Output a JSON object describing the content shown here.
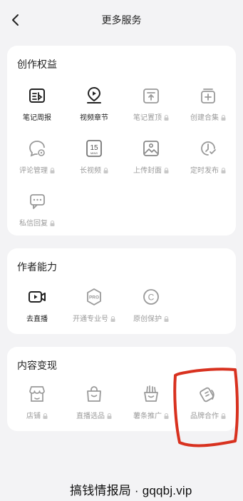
{
  "nav": {
    "title": "更多服务",
    "back_icon": "chevron-left-icon"
  },
  "sections": [
    {
      "title": "创作权益",
      "items": [
        {
          "label": "笔记周报",
          "icon": "report-icon",
          "locked": false
        },
        {
          "label": "视频章节",
          "icon": "video-chapter-icon",
          "locked": false
        },
        {
          "label": "笔记置顶",
          "icon": "pin-top-icon",
          "locked": true
        },
        {
          "label": "创建合集",
          "icon": "collection-icon",
          "locked": true
        },
        {
          "label": "评论管理",
          "icon": "comment-manage-icon",
          "locked": true
        },
        {
          "label": "长视频",
          "icon": "long-video-icon",
          "icon_text": "15",
          "icon_subtext": "MINS",
          "locked": true
        },
        {
          "label": "上传封面",
          "icon": "upload-cover-icon",
          "locked": true
        },
        {
          "label": "定时发布",
          "icon": "schedule-icon",
          "locked": true
        },
        {
          "label": "私信回复",
          "icon": "message-reply-icon",
          "locked": true
        }
      ]
    },
    {
      "title": "作者能力",
      "items": [
        {
          "label": "去直播",
          "icon": "live-icon",
          "locked": false
        },
        {
          "label": "开通专业号",
          "icon": "pro-icon",
          "icon_text": "PRO",
          "locked": true
        },
        {
          "label": "原创保护",
          "icon": "copyright-icon",
          "icon_text": "C",
          "locked": true
        }
      ]
    },
    {
      "title": "内容变现",
      "items": [
        {
          "label": "店铺",
          "icon": "shop-icon",
          "locked": true
        },
        {
          "label": "直播选品",
          "icon": "shopping-bag-icon",
          "locked": true
        },
        {
          "label": "薯条推广",
          "icon": "fries-icon",
          "locked": true
        },
        {
          "label": "品牌合作",
          "icon": "brand-coop-icon",
          "locked": true
        }
      ]
    }
  ],
  "annotation_color": "#d8311f",
  "watermark": "搞钱情报局 · gqqbj.vip"
}
